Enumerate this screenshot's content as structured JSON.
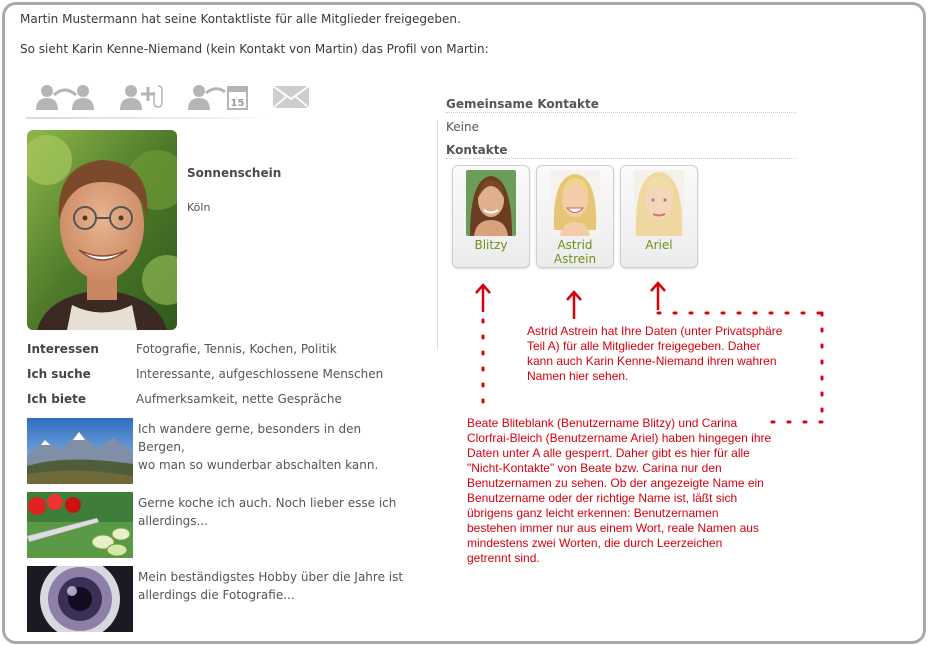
{
  "intro": {
    "line1": "Martin Mustermann hat seine Kontaktliste für alle Mitglieder freigegeben.",
    "line2": "So sieht Karin Kenne-Niemand (kein Kontakt von Martin) das Profil von Martin:"
  },
  "toolbar": {
    "icons": [
      "contacts-link-icon",
      "add-contact-icon",
      "schedule-date-icon",
      "mail-icon"
    ],
    "calendar_day": "15"
  },
  "profile": {
    "nickname": "Sonnenschein",
    "city": "Köln",
    "details": [
      {
        "label": "Interessen",
        "value": "Fotografie, Tennis, Kochen, Politik"
      },
      {
        "label": "Ich suche",
        "value": "Interessante, aufgeschlossene Menschen"
      },
      {
        "label": "Ich biete",
        "value": "Aufmerksamkeit, nette Gespräche"
      }
    ],
    "hobbies": [
      {
        "line1": "Ich wandere gerne, besonders in den Bergen,",
        "line2": "wo man so wunderbar abschalten kann."
      },
      {
        "line1": "Gerne koche ich auch. Noch lieber esse ich",
        "line2": "allerdings..."
      },
      {
        "line1": "Mein beständigstes Hobby über die Jahre ist",
        "line2": "allerdings die Fotografie..."
      }
    ]
  },
  "shared_contacts": {
    "title": "Gemeinsame Kontakte",
    "value": "Keine"
  },
  "contacts": {
    "title": "Kontakte",
    "items": [
      {
        "line1": "Blitzy",
        "line2": ""
      },
      {
        "line1": "Astrid",
        "line2": "Astrein"
      },
      {
        "line1": "Ariel",
        "line2": ""
      }
    ]
  },
  "annotations": {
    "astrid": [
      "Astrid Astrein hat Ihre Daten (unter Privatsphäre",
      "Teil A) für alle Mitglieder freigegeben. Daher",
      "kann auch Karin Kenne-Niemand ihren wahren",
      "Namen hier sehen."
    ],
    "beate": [
      "Beate Bliteblank (Benutzername Blitzy) und Carina",
      "Clorfrai-Bleich (Benutzername Ariel) haben hingegen ihre",
      "Daten unter A alle gesperrt. Daher gibt es hier für alle",
      "\"Nicht-Kontakte\" von Beate bzw. Carina nur den",
      "Benutzernamen zu sehen. Ob der angezeigte Name ein",
      "Benutzername oder der richtige Name ist, läßt sich",
      "übrigens ganz leicht erkennen: Benutzernamen",
      "bestehen immer nur aus einem Wort, reale Namen aus",
      "mindestens zwei Worten, die durch Leerzeichen",
      "getrennt sind."
    ]
  },
  "colors": {
    "annotation_red": "#d8000c",
    "contact_name_green": "#6f8f1f",
    "frame_gray": "#a7aaa9"
  }
}
